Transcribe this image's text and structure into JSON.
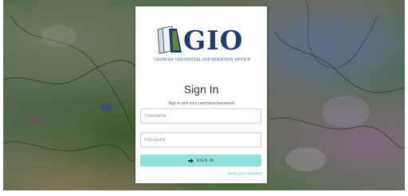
{
  "brand": {
    "logo_text": "GIO",
    "logo_subtitle": "GEORGIA GEOSPATIAL INFORMATION OFFICE"
  },
  "login": {
    "title": "Sign In",
    "subtitle": "Sign in with your username/password",
    "username_placeholder": "Username",
    "username_value": "",
    "password_placeholder": "Password",
    "password_value": "",
    "signin_label": "SIGN IN",
    "reset_label": "Reset your password"
  },
  "colors": {
    "button": "#8fe3da",
    "link": "#59b9c7",
    "logo": "#1f3e6e"
  },
  "icons": {
    "signin": "arrow-right-icon"
  }
}
